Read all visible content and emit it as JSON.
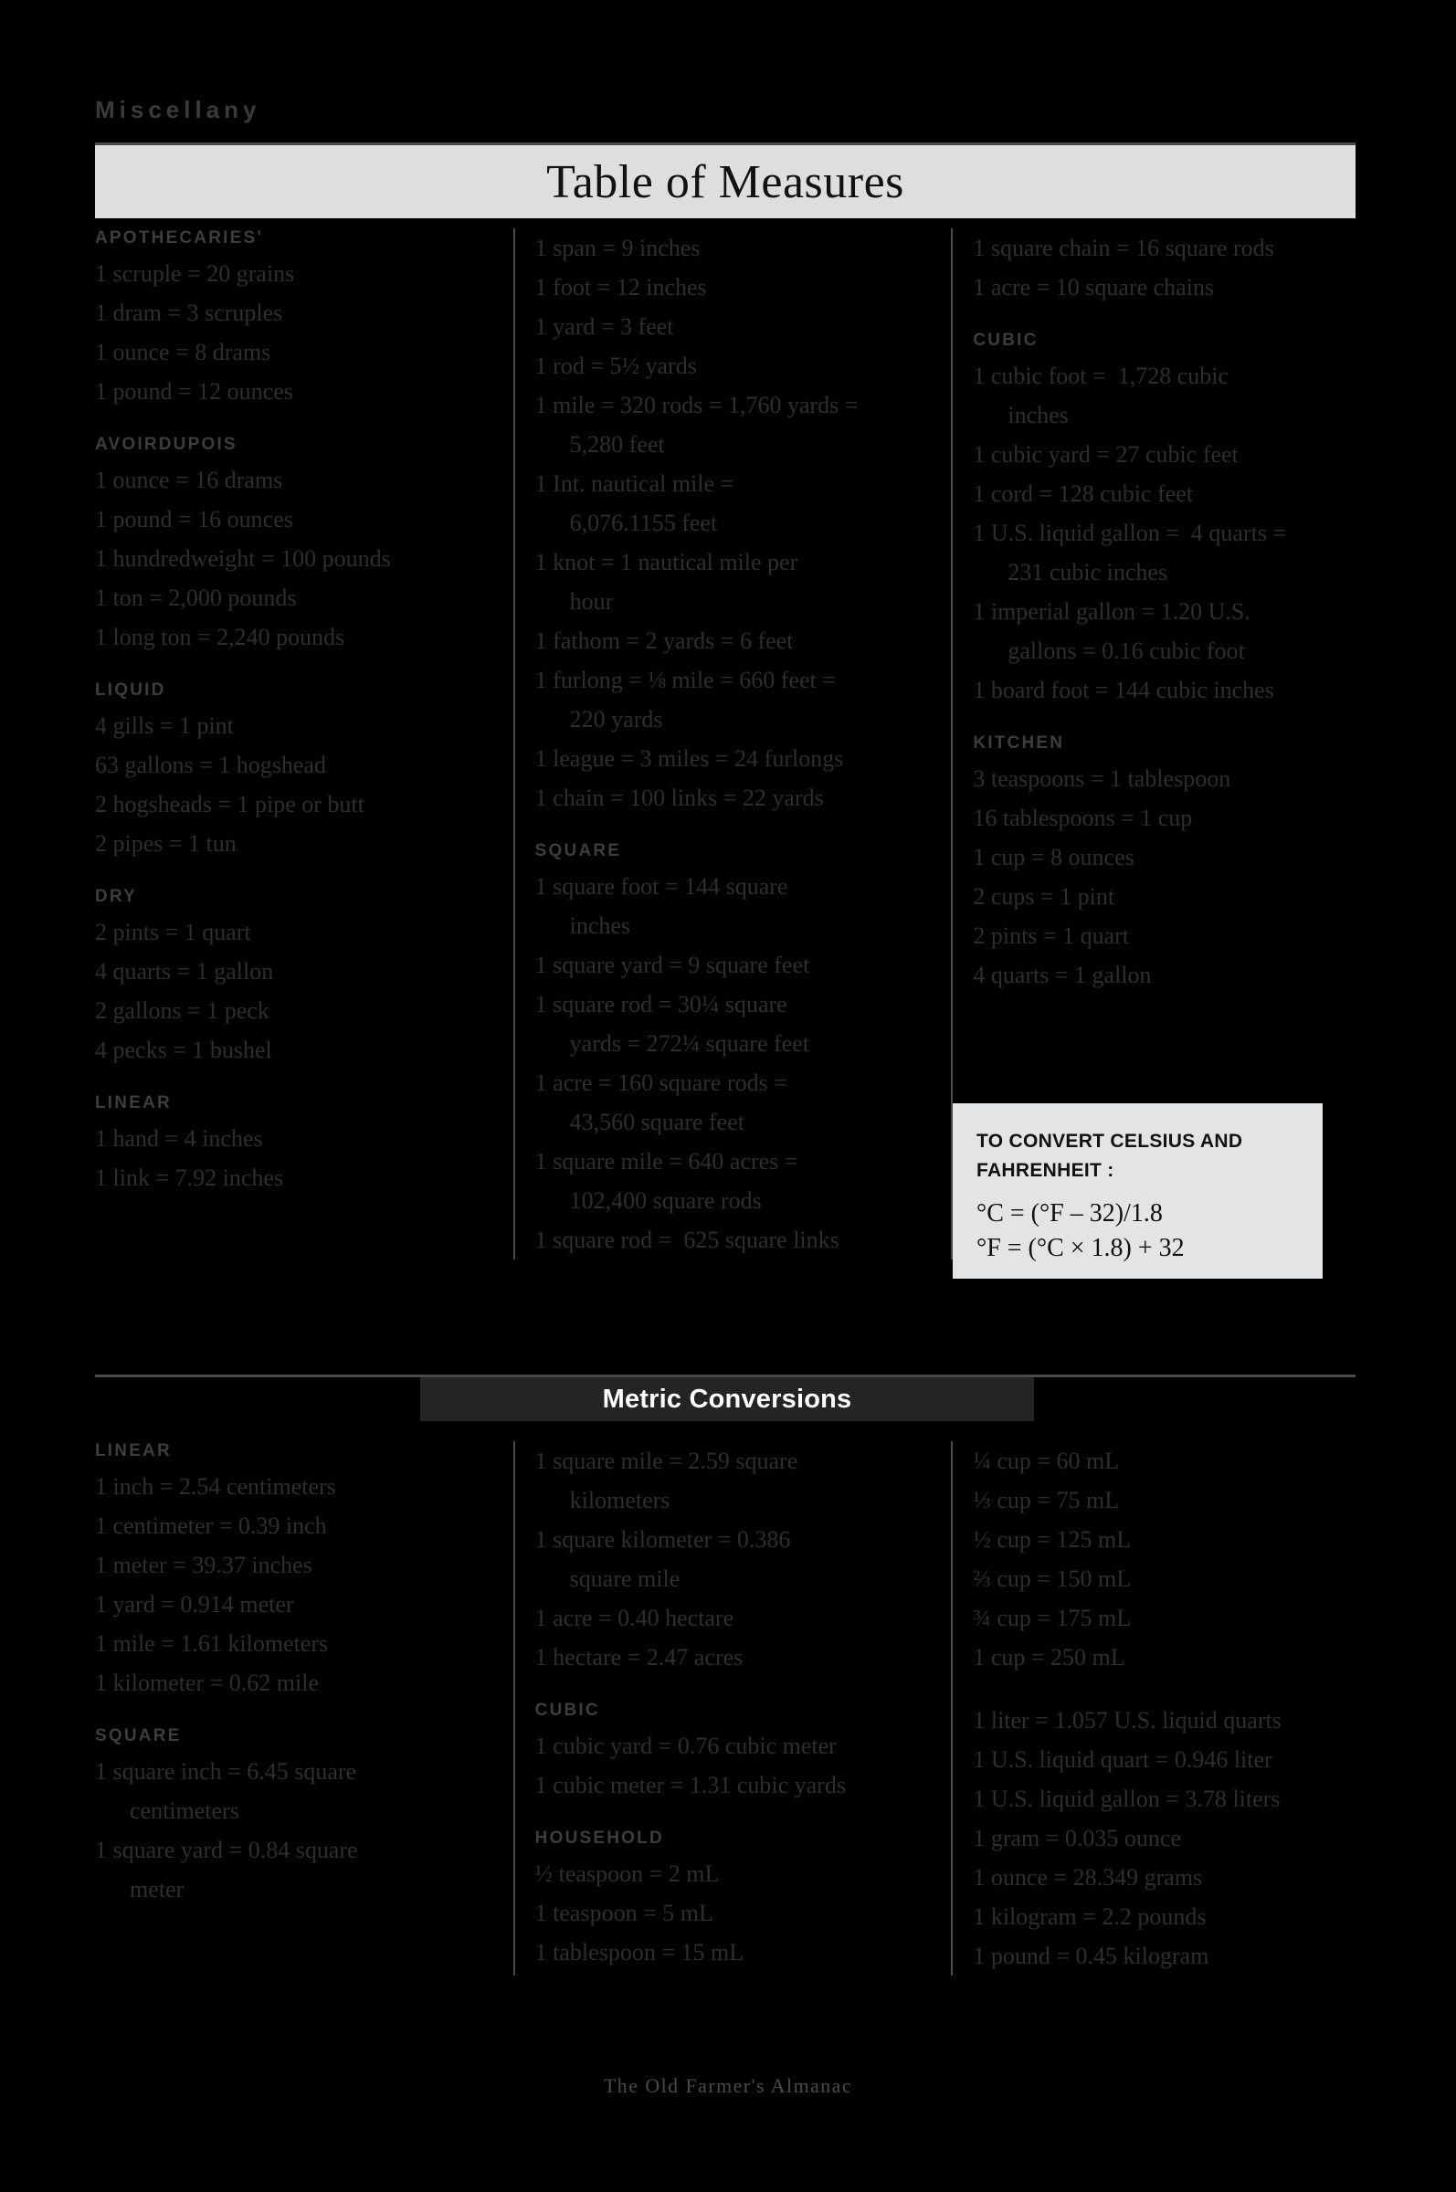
{
  "kicker": "Miscellany",
  "title": "Table of Measures",
  "footer": "The Old Farmer's Almanac",
  "metric_band": "Metric Conversions",
  "celsius_box": {
    "title_line1": "TO CONVERT CELSIUS AND",
    "title_line2": "FAHRENHEIT :",
    "formula_c": "°C = (°F  –  32)/1.8",
    "formula_f": "°F = (°C × 1.8) + 32"
  },
  "colors": {
    "background": "#000000",
    "banner": "#dddedf",
    "box": "#e3e4e5",
    "band": "#242424",
    "rule": "#4a4a4a",
    "body_text": "#2e2e2e",
    "head_text": "#3d3d3d"
  },
  "top": {
    "col1": [
      {
        "heading": "APOTHECARIES'",
        "lines": [
          "1 scruple = 20 grains",
          "1 dram = 3 scruples",
          "1 ounce = 8 drams",
          "1 pound = 12 ounces"
        ]
      },
      {
        "heading": "AVOIRDUPOIS",
        "lines": [
          "1 ounce = 16 drams",
          "1 pound = 16 ounces",
          "1 hundredweight = 100 pounds",
          "1 ton = 2,000 pounds",
          "1 long ton = 2,240 pounds"
        ]
      },
      {
        "heading": "LIQUID",
        "lines": [
          "4 gills = 1 pint",
          "63 gallons = 1 hogshead",
          "2 hogsheads = 1 pipe or butt",
          "2 pipes = 1 tun"
        ]
      },
      {
        "heading": "DRY",
        "lines": [
          "2 pints = 1 quart",
          "4 quarts = 1 gallon",
          "2 gallons = 1 peck",
          "4 pecks = 1 bushel"
        ]
      },
      {
        "heading": "LINEAR",
        "lines": [
          "1 hand = 4 inches",
          "1 link = 7.92 inches"
        ]
      }
    ],
    "col2": [
      {
        "heading": "",
        "lines": [
          "1 span = 9 inches",
          "1 foot = 12 inches",
          "1 yard = 3 feet",
          "1 rod = 5½ yards",
          "1 mile = 320 rods = 1,760 yards =",
          "    5,280 feet",
          "1 Int. nautical mile =",
          "    6,076.1155 feet",
          "1 knot = 1 nautical mile per",
          "    hour",
          "1 fathom = 2 yards = 6 feet",
          "1 furlong = ⅛ mile = 660 feet =",
          "    220 yards",
          "1 league = 3 miles = 24 furlongs",
          "1 chain = 100 links = 22 yards"
        ]
      },
      {
        "heading": "SQUARE",
        "lines": [
          "1 square foot = 144 square",
          "    inches",
          "1 square yard = 9 square feet",
          "1 square rod = 30¼ square",
          "    yards = 272¼ square feet",
          "1 acre = 160 square rods =",
          "    43,560 square feet",
          "1 square mile = 640 acres =",
          "    102,400 square rods",
          "1 square rod =  625 square links"
        ]
      }
    ],
    "col3": [
      {
        "heading": "",
        "lines": [
          "1 square chain = 16 square rods",
          "1 acre = 10 square chains"
        ]
      },
      {
        "heading": "CUBIC",
        "lines": [
          "1 cubic foot =  1,728 cubic",
          "    inches",
          "1 cubic yard = 27 cubic feet",
          "1 cord = 128 cubic feet",
          "1 U.S. liquid gallon =  4 quarts =",
          "    231 cubic inches",
          "1 imperial gallon = 1.20 U.S.",
          "    gallons = 0.16 cubic foot",
          "1 board foot = 144 cubic inches"
        ]
      },
      {
        "heading": "KITCHEN",
        "lines": [
          "3 teaspoons = 1 tablespoon",
          "16 tablespoons = 1 cup",
          "1 cup = 8 ounces",
          "2 cups = 1 pint",
          "2 pints = 1 quart",
          "4 quarts = 1 gallon"
        ]
      }
    ]
  },
  "bottom": {
    "col1": [
      {
        "heading": "LINEAR",
        "lines": [
          "1 inch = 2.54 centimeters",
          "1 centimeter = 0.39 inch",
          "1 meter = 39.37 inches",
          "1 yard = 0.914 meter",
          "1 mile = 1.61 kilometers",
          "1 kilometer = 0.62 mile"
        ]
      },
      {
        "heading": "SQUARE",
        "lines": [
          "1 square inch = 6.45 square",
          "    centimeters",
          "1 square yard = 0.84 square",
          "    meter"
        ]
      }
    ],
    "col2": [
      {
        "heading": "",
        "lines": [
          "1 square mile = 2.59 square",
          "    kilometers",
          "1 square kilometer = 0.386",
          "    square mile",
          "1 acre = 0.40 hectare",
          "1 hectare = 2.47 acres"
        ]
      },
      {
        "heading": "CUBIC",
        "lines": [
          "1 cubic yard = 0.76 cubic meter",
          "1 cubic meter = 1.31 cubic yards"
        ]
      },
      {
        "heading": "HOUSEHOLD",
        "lines": [
          "½ teaspoon = 2 mL",
          "1 teaspoon = 5 mL",
          "1 tablespoon = 15 mL"
        ]
      }
    ],
    "col3": [
      {
        "heading": "",
        "lines": [
          "¼ cup = 60 mL",
          "⅓ cup = 75 mL",
          "½ cup = 125 mL",
          "⅔ cup = 150 mL",
          "¾ cup = 175 mL",
          "1 cup = 250 mL"
        ]
      },
      {
        "heading": "",
        "lines": [
          "1 liter = 1.057 U.S. liquid quarts",
          "1 U.S. liquid quart = 0.946 liter",
          "1 U.S. liquid gallon = 3.78 liters",
          "1 gram = 0.035 ounce",
          "1 ounce = 28.349 grams",
          "1 kilogram = 2.2 pounds",
          "1 pound = 0.45 kilogram"
        ]
      }
    ]
  }
}
